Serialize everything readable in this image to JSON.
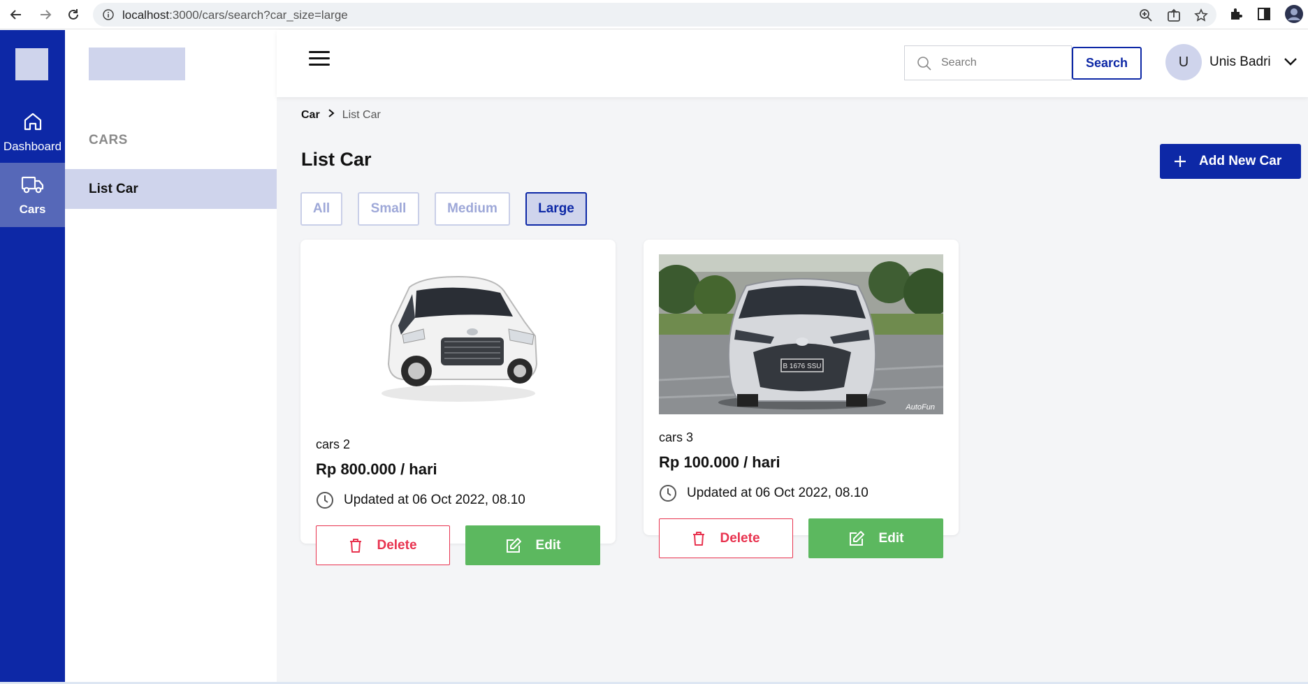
{
  "browser": {
    "url_host": "localhost",
    "url_rest": ":3000/cars/search?car_size=large",
    "icons": [
      "back-icon",
      "forward-icon",
      "reload-icon",
      "info-icon",
      "zoom-icon",
      "share-icon",
      "star-icon",
      "extensions-icon",
      "side-panel-icon",
      "profile-icon"
    ]
  },
  "rail": {
    "items": [
      {
        "label": "Dashboard",
        "icon": "home-icon"
      },
      {
        "label": "Cars",
        "icon": "truck-icon"
      }
    ]
  },
  "sidebar": {
    "heading": "CARS",
    "items": [
      {
        "label": "List Car"
      }
    ]
  },
  "topbar": {
    "search_placeholder": "Search",
    "search_button": "Search",
    "avatar_initial": "U",
    "user_name": "Unis Badri"
  },
  "breadcrumb": {
    "root": "Car",
    "current": "List Car"
  },
  "page": {
    "title": "List Car",
    "add_button": "Add New Car"
  },
  "filters": [
    {
      "label": "All",
      "active": false
    },
    {
      "label": "Small",
      "active": false
    },
    {
      "label": "Medium",
      "active": false
    },
    {
      "label": "Large",
      "active": true
    }
  ],
  "cars": [
    {
      "name": "cars 2",
      "price": "Rp 800.000 / hari",
      "updated": "Updated at 06 Oct 2022, 08.10",
      "delete_label": "Delete",
      "edit_label": "Edit",
      "plate": "",
      "watermark": ""
    },
    {
      "name": "cars 3",
      "price": "Rp 100.000 / hari",
      "updated": "Updated at 06 Oct 2022, 08.10",
      "delete_label": "Delete",
      "edit_label": "Edit",
      "plate": "B 1676 SSU",
      "watermark": "AutoFun"
    }
  ],
  "colors": {
    "primary": "#0d28a6",
    "primary_light": "#cfd4ec",
    "danger": "#e8334f",
    "success": "#5cb85f",
    "background": "#f4f5f7"
  }
}
